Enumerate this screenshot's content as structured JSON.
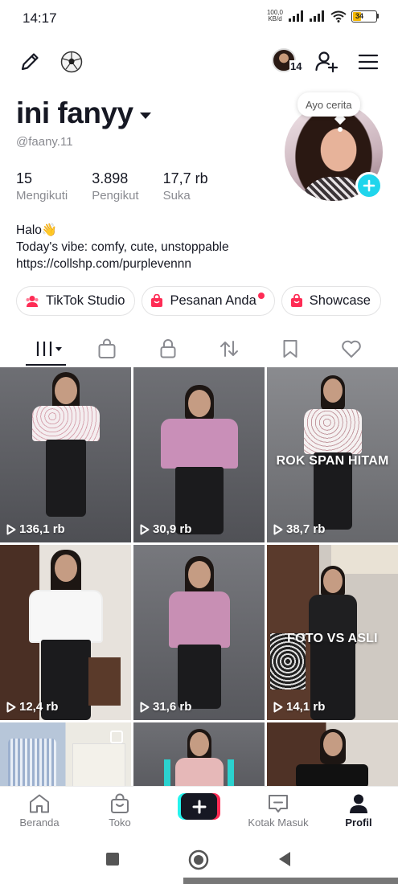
{
  "status_bar": {
    "time": "14:17",
    "net_speed_value": "100,0",
    "net_speed_unit": "KB/d",
    "battery": "34",
    "battery_level": 0.34
  },
  "top_nav": {
    "edit_icon": "pencil-icon",
    "soccer_icon": "soccer-ball-icon",
    "story_count": "14",
    "add_friend_icon": "add-person-icon",
    "menu_icon": "hamburger-menu-icon"
  },
  "profile": {
    "name": "ini fanyy",
    "username": "@faany.11",
    "bubble_text": "Ayo cerita",
    "stats": [
      {
        "value": "15",
        "label": "Mengikuti"
      },
      {
        "value": "3.898",
        "label": "Pengikut"
      },
      {
        "value": "17,7 rb",
        "label": "Suka"
      }
    ],
    "bio": {
      "line1": "Halo👋",
      "line2": "Today's vibe: comfy, cute, unstoppable",
      "link": "https://collshp.com/purplevennn"
    }
  },
  "pills": [
    {
      "label": "TikTok Studio",
      "icon": "people-icon",
      "has_dot": false
    },
    {
      "label": "Pesanan Anda",
      "icon": "shopping-bag-icon",
      "has_dot": true
    },
    {
      "label": "Showcase",
      "icon": "shopping-bag-icon",
      "has_dot": false
    }
  ],
  "tabs": [
    "grid-icon",
    "shopping-bag-icon",
    "lock-icon",
    "repost-icon",
    "bookmark-icon",
    "heart-icon"
  ],
  "videos": [
    {
      "views": "136,1 rb",
      "overlay": ""
    },
    {
      "views": "30,9 rb",
      "overlay": ""
    },
    {
      "views": "38,7 rb",
      "overlay": "ROK SPAN HITAM"
    },
    {
      "views": "12,4 rb",
      "overlay": ""
    },
    {
      "views": "31,6 rb",
      "overlay": ""
    },
    {
      "views": "14,1 rb",
      "overlay": "FOTO VS ASLI"
    },
    {
      "views": "",
      "overlay": ""
    },
    {
      "views": "",
      "overlay": ""
    },
    {
      "views": "",
      "overlay": ""
    }
  ],
  "bottom_nav": {
    "home": "Beranda",
    "shop": "Toko",
    "inbox": "Kotak Masuk",
    "profile": "Profil"
  },
  "colors": {
    "accent_cyan": "#25f4ee",
    "accent_red": "#fe2c55",
    "add_button": "#20d5ec",
    "text_primary": "#161823",
    "text_secondary": "#8a8b91"
  }
}
